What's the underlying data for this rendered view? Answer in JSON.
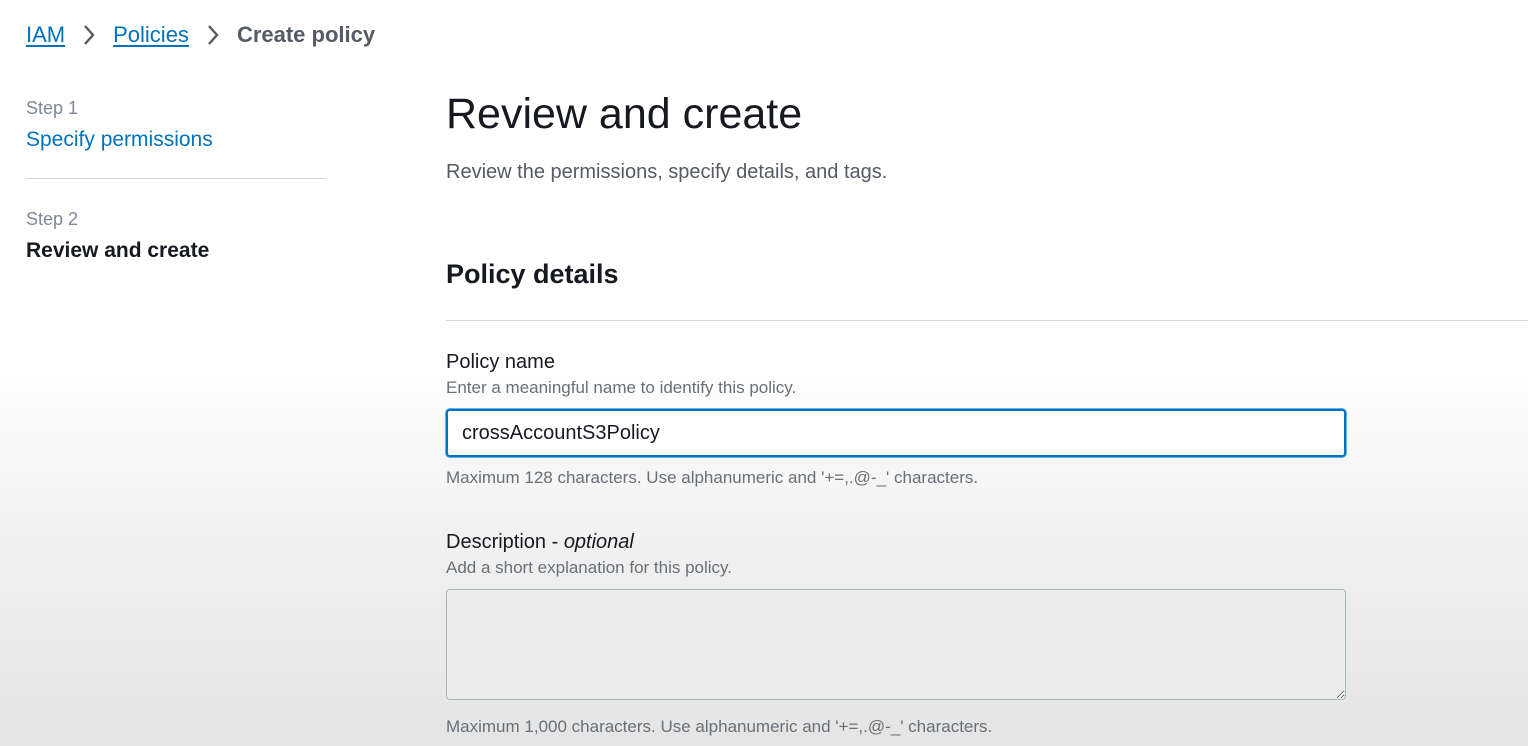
{
  "breadcrumb": {
    "items": [
      {
        "label": "IAM"
      },
      {
        "label": "Policies"
      },
      {
        "label": "Create policy"
      }
    ]
  },
  "steps": [
    {
      "number": "Step 1",
      "title": "Specify permissions"
    },
    {
      "number": "Step 2",
      "title": "Review and create"
    }
  ],
  "main": {
    "title": "Review and create",
    "description": "Review the permissions, specify details, and tags.",
    "section_title": "Policy details"
  },
  "policy_name": {
    "label": "Policy name",
    "description": "Enter a meaningful name to identify this policy.",
    "value": "crossAccountS3Policy",
    "constraint": "Maximum 128 characters. Use alphanumeric and '+=,.@-_' characters."
  },
  "description_field": {
    "label": "Description - ",
    "label_optional": "optional",
    "description": "Add a short explanation for this policy.",
    "value": "",
    "constraint": "Maximum 1,000 characters. Use alphanumeric and '+=,.@-_' characters."
  },
  "icons": {
    "breadcrumb_separator": "chevron-right-icon"
  },
  "colors": {
    "link": "#0073bb",
    "text": "#16191f",
    "muted": "#687078",
    "focus": "#0073bb"
  }
}
